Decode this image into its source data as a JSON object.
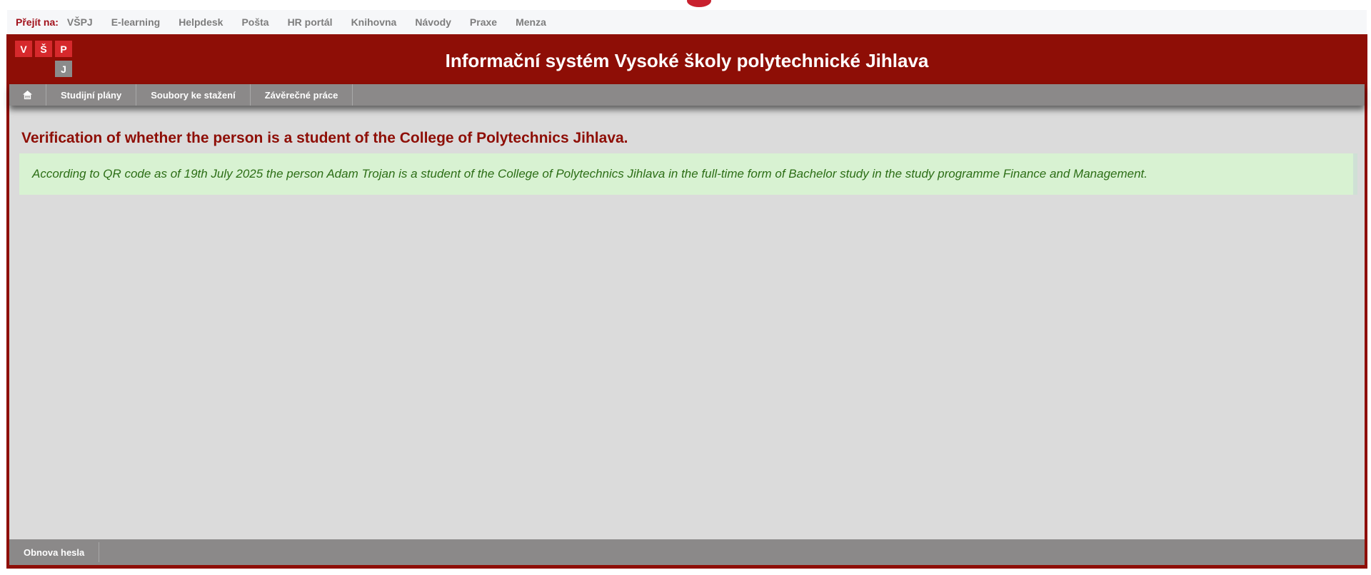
{
  "goto_bar": {
    "label": "Přejít na:",
    "links": [
      "VŠPJ",
      "E-learning",
      "Helpdesk",
      "Pošta",
      "HR portál",
      "Knihovna",
      "Návody",
      "Praxe",
      "Menza"
    ]
  },
  "logo": {
    "letters": [
      "V",
      "Š",
      "P",
      "J"
    ]
  },
  "header": {
    "title": "Informační systém Vysoké školy polytechnické Jihlava"
  },
  "nav": {
    "home_icon": "home-icon",
    "items": [
      "Studijní plány",
      "Soubory ke stažení",
      "Závěrečné práce"
    ]
  },
  "main": {
    "page_title": "Verification of whether the person is a student of the College of Polytechnics Jihlava.",
    "message": "According to QR code as of 19th July 2025 the person Adam Trojan is a student of the College of Polytechnics Jihlava in the full-time form of Bachelor study in the study programme Finance and Management."
  },
  "footer": {
    "items": [
      "Obnova hesla"
    ]
  },
  "colors": {
    "brand_red": "#8e0e06",
    "logo_red": "#d6292c",
    "nav_gray": "#8b8989",
    "content_bg": "#dbdbdb",
    "success_bg": "#d8f2d2",
    "success_text": "#2c6e16"
  }
}
